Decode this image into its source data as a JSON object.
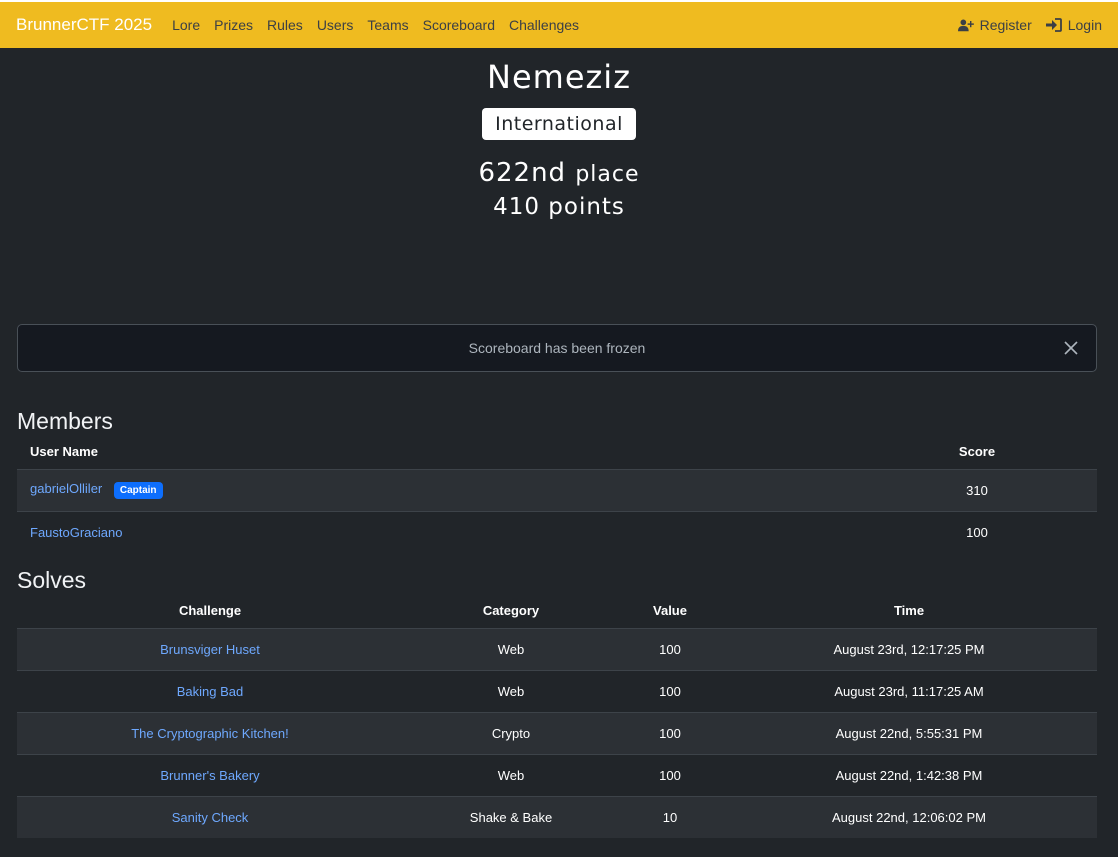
{
  "nav": {
    "brand": "BrunnerCTF 2025",
    "links": [
      "Lore",
      "Prizes",
      "Rules",
      "Users",
      "Teams",
      "Scoreboard",
      "Challenges"
    ],
    "register": "Register",
    "login": "Login"
  },
  "team": {
    "name": "Nemeziz",
    "affiliation": "International",
    "place_number": "622nd",
    "place_word": "place",
    "points": "410 points"
  },
  "alert": {
    "message": "Scoreboard has been frozen"
  },
  "members": {
    "title": "Members",
    "headers": {
      "user": "User Name",
      "score": "Score"
    },
    "rows": [
      {
        "name": "gabrielOlliler",
        "badge": "Captain",
        "score": "310"
      },
      {
        "name": "FaustoGraciano",
        "score": "100"
      }
    ]
  },
  "solves": {
    "title": "Solves",
    "headers": {
      "challenge": "Challenge",
      "category": "Category",
      "value": "Value",
      "time": "Time"
    },
    "rows": [
      {
        "challenge": "Brunsviger Huset",
        "category": "Web",
        "value": "100",
        "time": "August 23rd, 12:17:25 PM"
      },
      {
        "challenge": "Baking Bad",
        "category": "Web",
        "value": "100",
        "time": "August 23rd, 11:17:25 AM"
      },
      {
        "challenge": "The Cryptographic Kitchen!",
        "category": "Crypto",
        "value": "100",
        "time": "August 22nd, 5:55:31 PM"
      },
      {
        "challenge": "Brunner's Bakery",
        "category": "Web",
        "value": "100",
        "time": "August 22nd, 1:42:38 PM"
      },
      {
        "challenge": "Sanity Check",
        "category": "Shake & Bake",
        "value": "10",
        "time": "August 22nd, 12:06:02 PM"
      }
    ]
  }
}
